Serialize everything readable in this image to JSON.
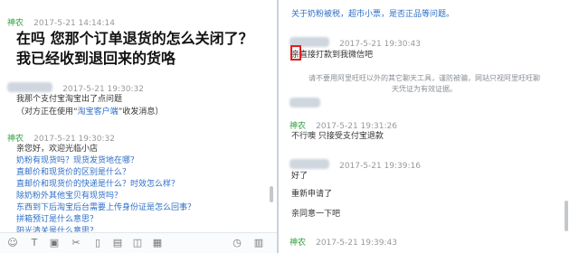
{
  "left": {
    "top_line": {
      "name": "神农",
      "time": "2017-5-21 14:14:14"
    },
    "big_message": "在吗  您那个订单退货的怎么关闭了？  我已经收到退回来的货咯",
    "customer2": {
      "time": "2017-5-21 19:30:32",
      "line1": "我那个支付宝淘宝出了点问题",
      "line2_prefix": "（对方正在使用“",
      "line2_link": "淘宝客户端",
      "line2_suffix": "”收发消息）"
    },
    "agent": {
      "name": "神农",
      "time": "2017-5-21 19:30:32",
      "greeting": "亲您好，欢迎光临小店",
      "faq": [
        "奶粉有现货吗？现货发货地在哪？",
        "直邮价和现货价的区别是什么？",
        "直邮价和现货价的快递是什么？时效怎么样？",
        "除奶粉外其他宝贝有现货吗？",
        "东西到下后淘宝后台需要上传身份证是怎么回事？",
        "拼箱预订是什么意思？",
        "阳光清关是什么意思？"
      ]
    },
    "toolbar_icons": [
      "emoji-icon",
      "text-icon",
      "image-icon",
      "scissors-icon",
      "video-icon",
      "file-icon",
      "shake-icon",
      "more-icon",
      "history-icon",
      "chat-record-icon"
    ]
  },
  "right": {
    "top_line": "关于奶粉被税，超市小票，是否正品等问题。",
    "msg1": {
      "time": "2017-5-21 19:30:43",
      "text": "亲直接打款到我微信吧"
    },
    "system_notice": "请不要用阿里旺旺以外的其它聊天工具，谨防被骗，网站只视阿里旺旺聊天凭证为有效证据。",
    "agent1": {
      "name": "神农",
      "time": "2017-5-21 19:31:26",
      "text": "不行噢 只接受支付宝退款"
    },
    "msg2": {
      "time": "2017-5-21 19:39:16",
      "lines": [
        "好了",
        "重新申请了",
        "亲同意一下吧"
      ]
    },
    "agent2": {
      "name": "神农",
      "time": "2017-5-21 19:39:43"
    }
  },
  "colors": {
    "link": "#2e6fc7",
    "agent_name": "#2e9e3e",
    "highlight": "#e02020"
  }
}
